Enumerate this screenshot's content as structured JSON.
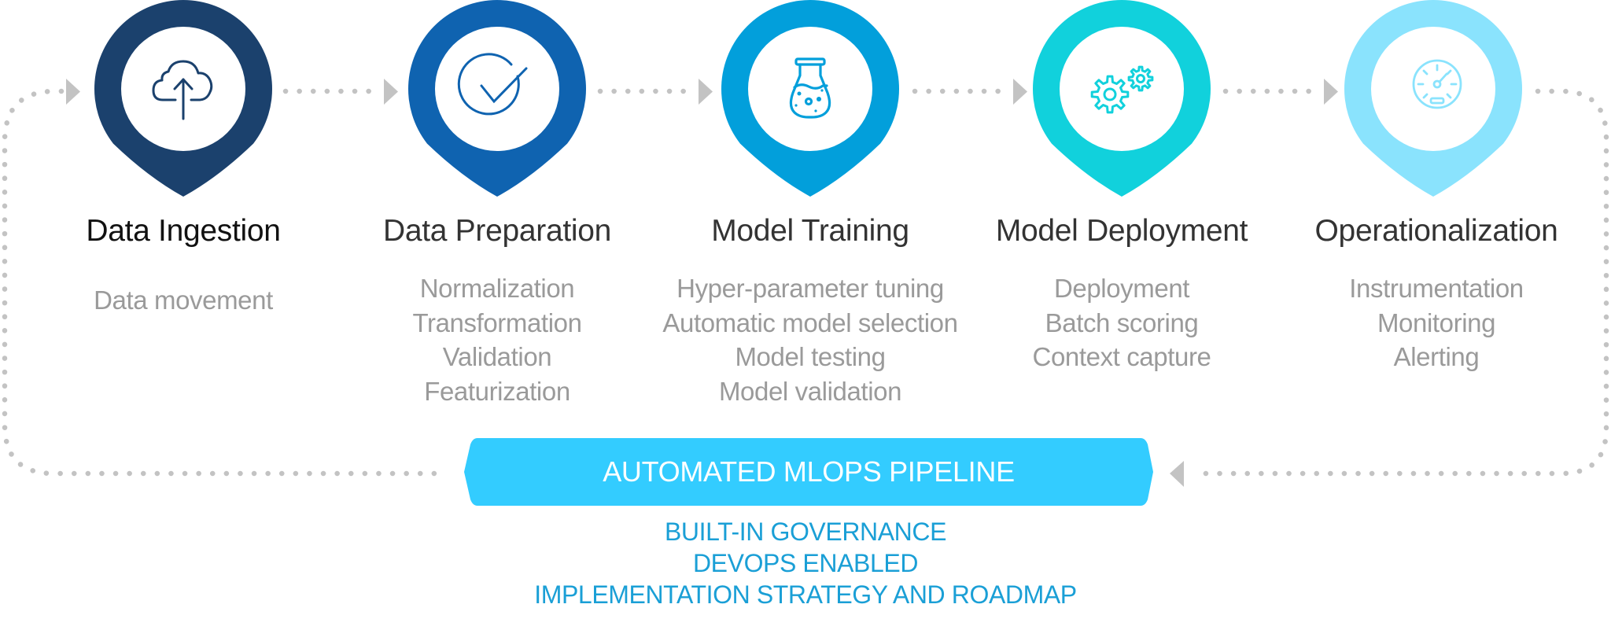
{
  "stages": [
    {
      "title": "Data Ingestion",
      "icon": "cloud-upload-icon",
      "color": "#1b416d",
      "items": [
        "Data movement"
      ]
    },
    {
      "title": "Data Preparation",
      "icon": "check-circle-icon",
      "color": "#0f63b0",
      "items": [
        "Normalization",
        "Transformation",
        "Validation",
        "Featurization"
      ]
    },
    {
      "title": "Model Training",
      "icon": "flask-icon",
      "color": "#029fdb",
      "items": [
        "Hyper-parameter tuning",
        "Automatic model selection",
        "Model testing",
        "Model validation"
      ]
    },
    {
      "title": "Model Deployment",
      "icon": "gears-icon",
      "color": "#11d1dc",
      "items": [
        "Deployment",
        "Batch scoring",
        "Context capture"
      ]
    },
    {
      "title": "Operationalization",
      "icon": "gauge-icon",
      "color": "#8ae3fd",
      "items": [
        "Instrumentation",
        "Monitoring",
        "Alerting"
      ]
    }
  ],
  "banner": {
    "label": "AUTOMATED MLOPS PIPELINE",
    "color": "#33ccff"
  },
  "footer": {
    "lines": [
      "BUILT-IN GOVERNANCE",
      "DEVOPS ENABLED",
      "IMPLEMENTATION STRATEGY AND ROADMAP"
    ],
    "color": "#1a9fd6"
  },
  "connector_color": "#c3c3c3"
}
